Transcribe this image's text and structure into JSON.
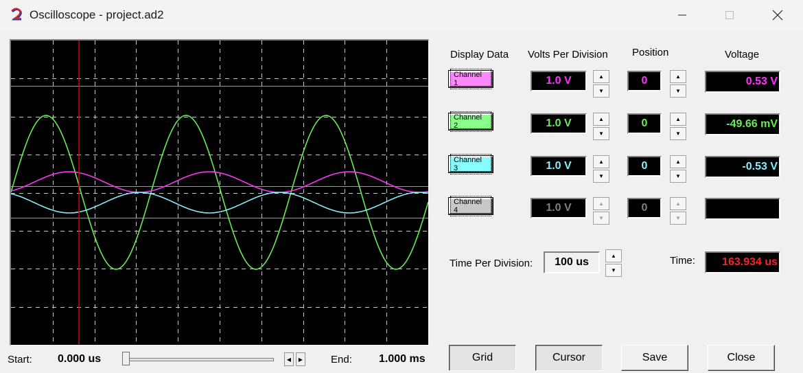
{
  "window": {
    "title": "Oscilloscope - project.ad2"
  },
  "colors": {
    "ch1": "#ff33ff",
    "ch2": "#66ee55",
    "ch3": "#88eeff",
    "ch4": "#c0c0c0",
    "time": "#ff2020",
    "cursor": "#dd0000"
  },
  "headers": {
    "display": "Display Data",
    "volts": "Volts Per Division",
    "position": "Position",
    "voltage": "Voltage"
  },
  "channels": [
    {
      "label": "Channel 1",
      "vdiv": "1.0 V",
      "position": "0",
      "voltage": "0.53  V",
      "color": "#ff33ff",
      "button_bg": "#ff88ff",
      "enabled": true
    },
    {
      "label": "Channel 2",
      "vdiv": "1.0 V",
      "position": "0",
      "voltage": "-49.66 mV",
      "color": "#66ee55",
      "button_bg": "#88ff88",
      "enabled": true
    },
    {
      "label": "Channel 3",
      "vdiv": "1.0 V",
      "position": "0",
      "voltage": "-0.53  V",
      "color": "#88eeff",
      "button_bg": "#88ffff",
      "enabled": true
    },
    {
      "label": "Channel 4",
      "vdiv": "1.0 V",
      "position": "0",
      "voltage": "",
      "color": "#808080",
      "button_bg": "#c8c8c8",
      "enabled": false
    }
  ],
  "timebase": {
    "label": "Time Per Division:",
    "value": "100 us"
  },
  "time": {
    "label": "Time:",
    "value": "163.934 us"
  },
  "range": {
    "start_label": "Start:",
    "start_value": "0.000 us",
    "end_label": "End:",
    "end_value": "1.000 ms",
    "slider": 0.0
  },
  "buttons": {
    "grid": "Grid",
    "cursor": "Cursor",
    "save": "Save",
    "close": "Close"
  },
  "cursor_time_fraction": 0.1639
}
